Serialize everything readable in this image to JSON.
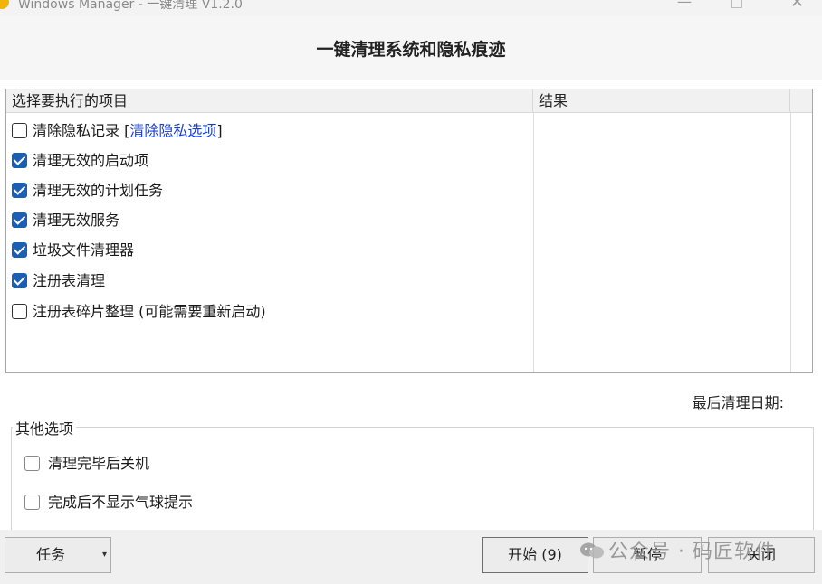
{
  "window": {
    "title": "Windows Manager - 一键清理 V1.2.0",
    "minimize_glyph": "—",
    "close_glyph": "✕"
  },
  "header": {
    "title": "一键清理系统和隐私痕迹"
  },
  "list": {
    "col_items": "选择要执行的项目",
    "col_result": "结果",
    "items": [
      {
        "label": "清除隐私记录",
        "checked": false,
        "link": "清除隐私选项"
      },
      {
        "label": "清理无效的启动项",
        "checked": true
      },
      {
        "label": "清理无效的计划任务",
        "checked": true
      },
      {
        "label": "清理无效服务",
        "checked": true
      },
      {
        "label": "垃圾文件清理器",
        "checked": true
      },
      {
        "label": "注册表清理",
        "checked": true
      },
      {
        "label": "注册表碎片整理 (可能需要重新启动)",
        "checked": false
      }
    ]
  },
  "last_clean_label": "最后清理日期:",
  "other_options": {
    "label": "其他选项",
    "items": [
      {
        "label": "清理完毕后关机",
        "checked": false
      },
      {
        "label": "完成后不显示气球提示",
        "checked": false
      }
    ]
  },
  "buttons": {
    "task": "任务",
    "task_arrow": "▾",
    "start": "开始 (9)",
    "pause": "暂停",
    "close": "关闭"
  },
  "watermark": {
    "text": "公众号 · 码匠软件"
  },
  "colors": {
    "checkbox_checked": "#1a5fb4",
    "link": "#1a3fcf"
  }
}
